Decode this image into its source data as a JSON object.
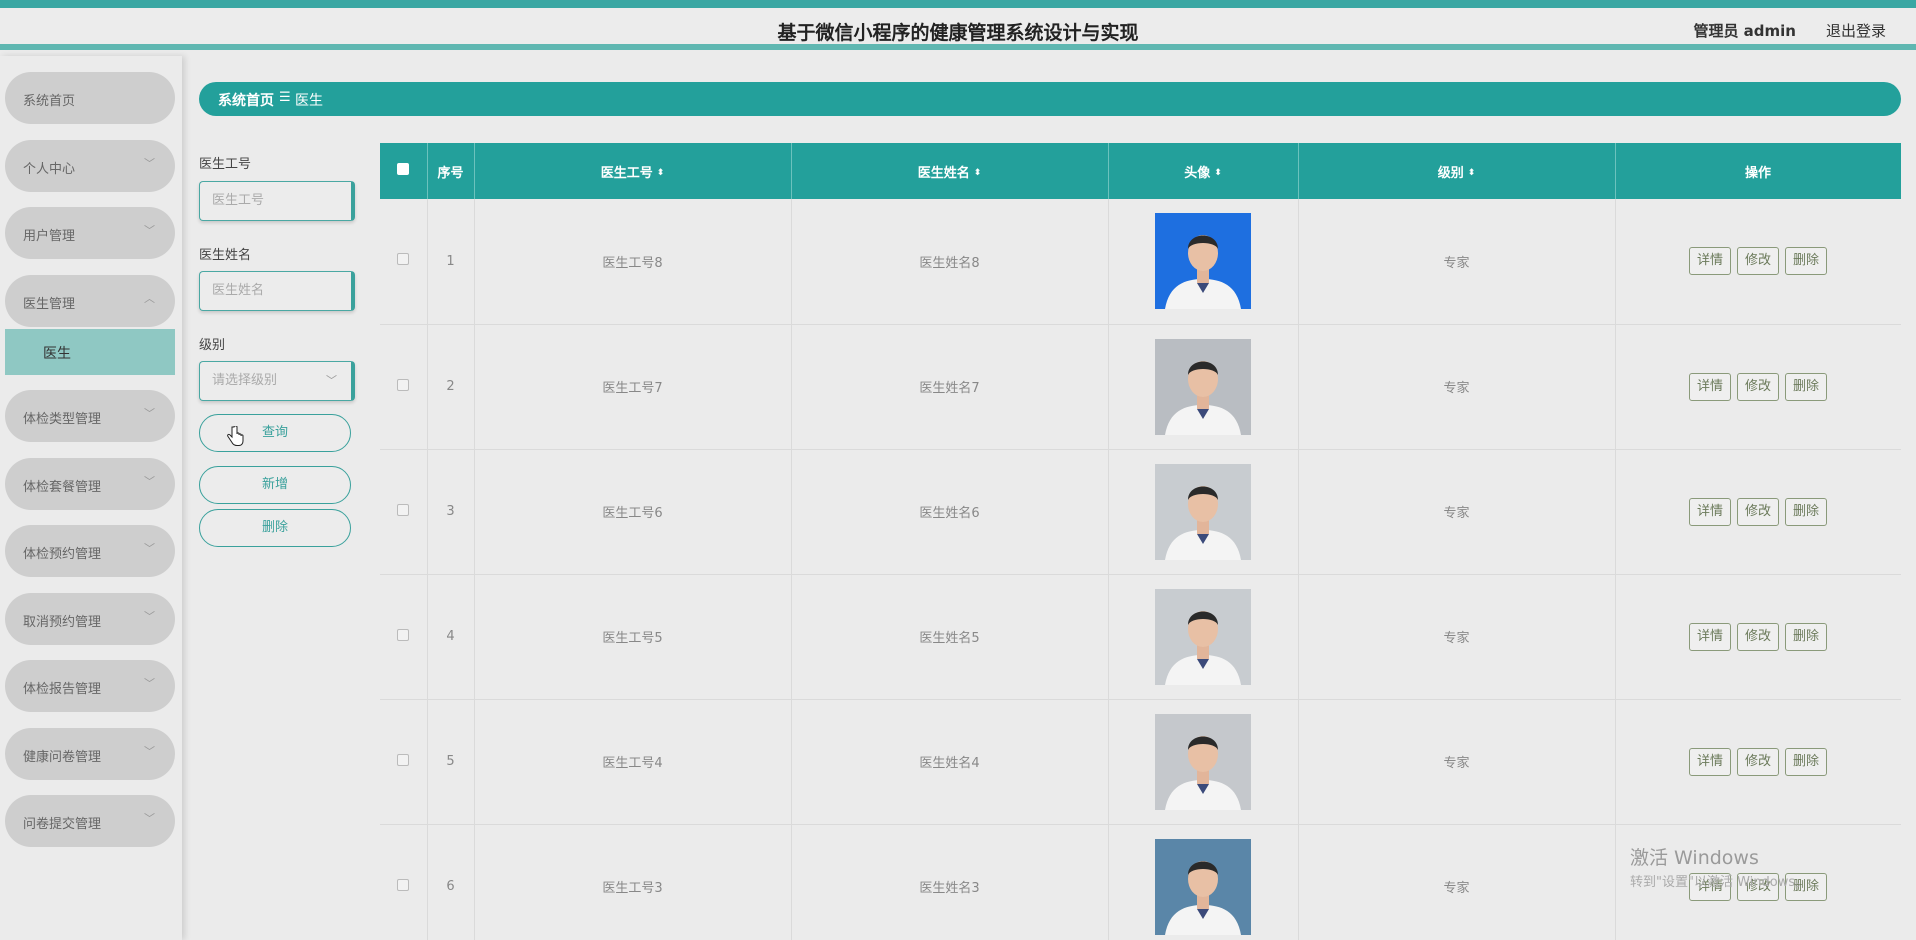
{
  "header": {
    "title": "基于微信小程序的健康管理系统设计与实现",
    "user": "管理员 admin",
    "logout": "退出登录"
  },
  "sidebar": {
    "items": [
      {
        "label": "系统首页",
        "expandable": false
      },
      {
        "label": "个人中心",
        "expandable": true,
        "expanded": false
      },
      {
        "label": "用户管理",
        "expandable": true,
        "expanded": false
      },
      {
        "label": "医生管理",
        "expandable": true,
        "expanded": true
      },
      {
        "label": "体检类型管理",
        "expandable": true,
        "expanded": false
      },
      {
        "label": "体检套餐管理",
        "expandable": true,
        "expanded": false
      },
      {
        "label": "体检预约管理",
        "expandable": true,
        "expanded": false
      },
      {
        "label": "取消预约管理",
        "expandable": true,
        "expanded": false
      },
      {
        "label": "体检报告管理",
        "expandable": true,
        "expanded": false
      },
      {
        "label": "健康问卷管理",
        "expandable": true,
        "expanded": false
      },
      {
        "label": "问卷提交管理",
        "expandable": true,
        "expanded": false
      }
    ],
    "submenu": {
      "label": "医生",
      "active": true
    }
  },
  "breadcrumb": {
    "home": "系统首页",
    "separator": "☰",
    "current": "医生"
  },
  "search": {
    "doctor_id_label": "医生工号",
    "doctor_id_placeholder": "医生工号",
    "doctor_name_label": "医生姓名",
    "doctor_name_placeholder": "医生姓名",
    "level_label": "级别",
    "level_placeholder": "请选择级别",
    "query_button": "查询",
    "add_button": "新增",
    "delete_button": "删除"
  },
  "table": {
    "columns": [
      "序号",
      "医生工号",
      "医生姓名",
      "头像",
      "级别",
      "操作"
    ],
    "actions": [
      "详情",
      "修改",
      "删除"
    ],
    "rows": [
      {
        "index": "1",
        "doctor_id": "医生工号8",
        "doctor_name": "医生姓名8",
        "level": "专家",
        "avatar_bg": "#1e6fe0"
      },
      {
        "index": "2",
        "doctor_id": "医生工号7",
        "doctor_name": "医生姓名7",
        "level": "专家",
        "avatar_bg": "#b9bdc2"
      },
      {
        "index": "3",
        "doctor_id": "医生工号6",
        "doctor_name": "医生姓名6",
        "level": "专家",
        "avatar_bg": "#c8ccd0"
      },
      {
        "index": "4",
        "doctor_id": "医生工号5",
        "doctor_name": "医生姓名5",
        "level": "专家",
        "avatar_bg": "#c8ccd0"
      },
      {
        "index": "5",
        "doctor_id": "医生工号4",
        "doctor_name": "医生姓名4",
        "level": "专家",
        "avatar_bg": "#c5c8cc"
      },
      {
        "index": "6",
        "doctor_id": "医生工号3",
        "doctor_name": "医生姓名3",
        "level": "专家",
        "avatar_bg": "#5a86a8"
      }
    ]
  },
  "watermark": {
    "line1": "激活 Windows",
    "line2": "转到\"设置\"以激活 Windows。"
  },
  "colors": {
    "accent": "#23a09b",
    "header_stripe": "#3aa7a3",
    "submenu_active": "#8fc8c3"
  }
}
